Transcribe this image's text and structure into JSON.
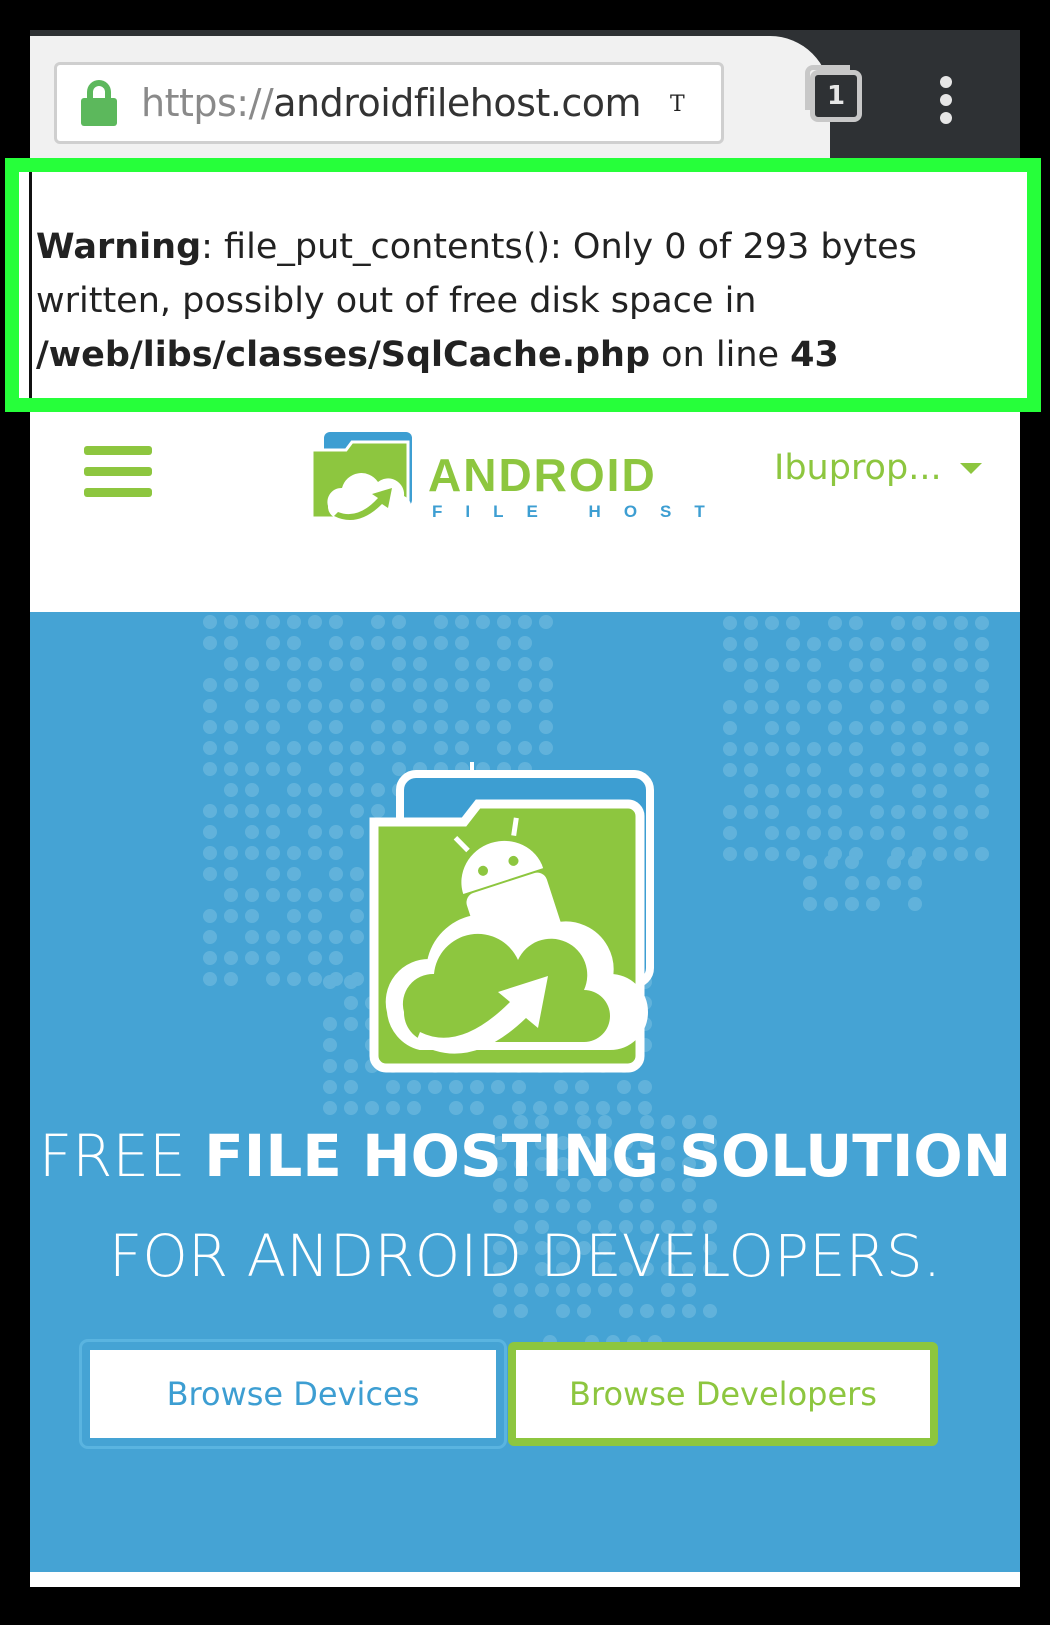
{
  "browser": {
    "url_scheme": "https://",
    "url_host": "androidfilehost.com",
    "cursor_char": "T",
    "tab_count": "1"
  },
  "warning": {
    "label": "Warning",
    "message": ": file_put_contents(): Only 0 of 293 bytes written, possibly out of free disk space in ",
    "path": "/web/libs/classes/SqlCache.php",
    "on_line": " on line ",
    "line_number": "43"
  },
  "header": {
    "logo_word": "ANDROID",
    "logo_sub": "FILE HOST",
    "user_name": "Ibuprop..."
  },
  "hero": {
    "line1_light": "FREE ",
    "line1_strong": "FILE HOSTING SOLUTION",
    "line2": "FOR ANDROID DEVELOPERS."
  },
  "buttons": {
    "browse_devices": "Browse Devices",
    "browse_developers": "Browse Developers"
  },
  "colors": {
    "brand_green": "#8dc63f",
    "brand_blue": "#45a3d4",
    "highlight_green": "#26ff3a"
  }
}
